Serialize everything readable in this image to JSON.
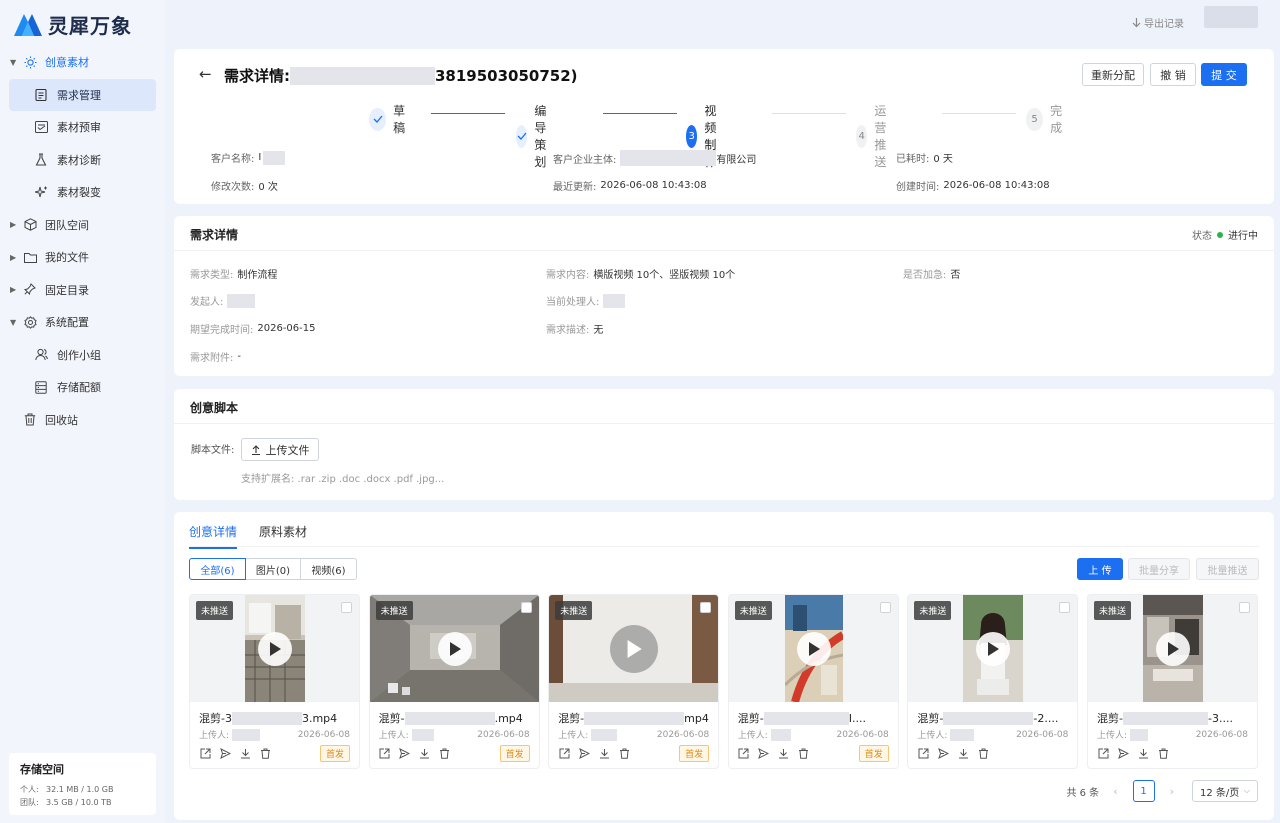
{
  "app": {
    "name": "灵犀万象"
  },
  "topbar": {
    "export_label": "导出记录"
  },
  "sidebar": {
    "items": [
      {
        "label": "创意素材",
        "icon": "sun-icon",
        "level": 0,
        "expanded": true,
        "active": true
      },
      {
        "label": "需求管理",
        "icon": "clipboard-icon",
        "level": 1,
        "selected": true
      },
      {
        "label": "素材预审",
        "icon": "review-icon",
        "level": 1
      },
      {
        "label": "素材诊断",
        "icon": "flask-icon",
        "level": 1
      },
      {
        "label": "素材裂变",
        "icon": "sparkle-icon",
        "level": 1
      },
      {
        "label": "团队空间",
        "icon": "cube-icon",
        "level": 0
      },
      {
        "label": "我的文件",
        "icon": "folder-icon",
        "level": 0
      },
      {
        "label": "固定目录",
        "icon": "pin-icon",
        "level": 0
      },
      {
        "label": "系统配置",
        "icon": "gear-icon",
        "level": 0,
        "expanded": true
      },
      {
        "label": "创作小组",
        "icon": "users-icon",
        "level": 1
      },
      {
        "label": "存储配额",
        "icon": "database-icon",
        "level": 1
      },
      {
        "label": "回收站",
        "icon": "trash-icon",
        "level": 0,
        "leaf": true
      }
    ],
    "storage": {
      "title": "存储空间",
      "personal_label": "个人:",
      "personal_value": "32.1 MB / 1.0 GB",
      "team_label": "团队:",
      "team_value": "3.5 GB / 10.0 TB"
    }
  },
  "header": {
    "title_prefix": "需求详情:",
    "title_suffix": "3819503050752)",
    "buttons": {
      "reassign": "重新分配",
      "revoke": "撤 销",
      "submit": "提 交"
    },
    "steps": [
      {
        "label": "草稿",
        "state": "done",
        "num": "1"
      },
      {
        "label": "编导策划",
        "state": "done",
        "num": "2"
      },
      {
        "label": "视频制作",
        "state": "current",
        "num": "3"
      },
      {
        "label": "运营推送",
        "state": "todo",
        "num": "4"
      },
      {
        "label": "完成",
        "state": "todo",
        "num": "5"
      }
    ],
    "info": {
      "customer_name_label": "客户名称:",
      "customer_name_value": "I",
      "entity_label": "客户企业主体:",
      "entity_value": "有限公司",
      "elapsed_label": "已耗时:",
      "elapsed_value": "0 天",
      "revisions_label": "修改次数:",
      "revisions_value": "0 次",
      "updated_label": "最近更新:",
      "updated_value": "2026-06-08 10:43:08",
      "created_label": "创建时间:",
      "created_value": "2026-06-08 10:43:08"
    }
  },
  "demand": {
    "title": "需求详情",
    "status_label": "状态",
    "status_value": "进行中",
    "type_label": "需求类型:",
    "type_value": "制作流程",
    "content_label": "需求内容:",
    "content_value": "横版视频 10个、竖版视频 10个",
    "urgent_label": "是否加急:",
    "urgent_value": "否",
    "initiator_label": "发起人:",
    "initiator_value": "",
    "handler_label": "当前处理人:",
    "handler_value": "",
    "deadline_label": "期望完成时间:",
    "deadline_value": "2026-06-15",
    "desc_label": "需求描述:",
    "desc_value": "无",
    "attach_label": "需求附件:",
    "attach_value": "-"
  },
  "script": {
    "title": "创意脚本",
    "file_label": "脚本文件:",
    "upload_label": "上传文件",
    "hint": "支持扩展名: .rar .zip .doc .docx .pdf .jpg..."
  },
  "assets": {
    "tabs": [
      "创意详情",
      "原料素材"
    ],
    "filters": [
      "全部(6)",
      "图片(0)",
      "视频(6)"
    ],
    "upload_btn": "上 传",
    "batch_share": "批量分享",
    "batch_push": "批量推送",
    "uploader_label": "上传人:",
    "cards": [
      {
        "tag": "未推送",
        "name_prefix": "混剪-3",
        "name_suffix": "3.mp4",
        "date": "2026-06-08",
        "badge": "首发",
        "thumb": "balcony"
      },
      {
        "tag": "未推送",
        "name_prefix": "混剪-",
        "name_suffix": ".mp4",
        "date": "2026-06-08",
        "badge": "首发",
        "thumb": "room"
      },
      {
        "tag": "未推送",
        "name_prefix": "混剪-",
        "name_suffix": "mp4",
        "date": "2026-06-08",
        "badge": "首发",
        "thumb": "wall"
      },
      {
        "tag": "未推送",
        "name_prefix": "混剪-",
        "name_suffix": "I....",
        "date": "2026-06-08",
        "badge": "首发",
        "thumb": "stair"
      },
      {
        "tag": "未推送",
        "name_prefix": "混剪-",
        "name_suffix": "-2....",
        "date": "2026-06-08",
        "badge": "",
        "thumb": "woman"
      },
      {
        "tag": "未推送",
        "name_prefix": "混剪-",
        "name_suffix": "-3....",
        "date": "2026-06-08",
        "badge": "",
        "thumb": "living"
      }
    ],
    "pager": {
      "total": "共 6 条",
      "page": "1",
      "size": "12 条/页"
    }
  }
}
